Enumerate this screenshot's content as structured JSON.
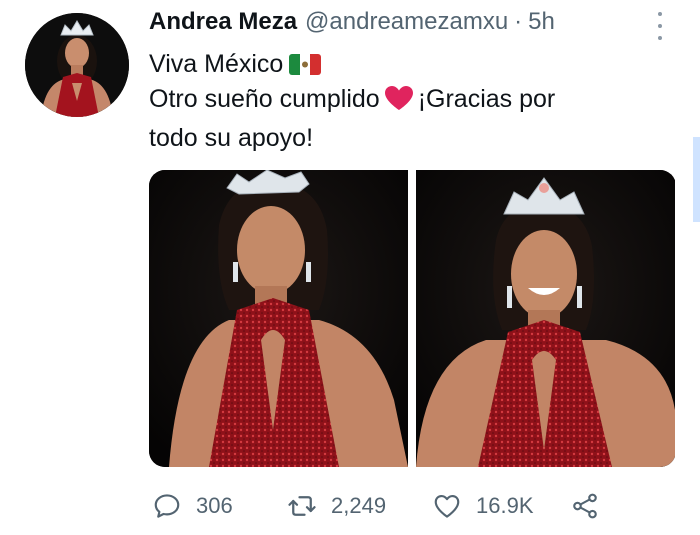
{
  "tweet": {
    "author_name": "Andrea Meza",
    "handle": "@andreamezamxu",
    "separator": "·",
    "time": "5h",
    "lines": [
      "Viva México",
      "Otro sueño cumplido",
      "¡Gracias por",
      "todo su apoyo!"
    ],
    "emoji": {
      "flag": "mexico-flag-icon",
      "heart": "red-heart-icon"
    }
  },
  "actions": {
    "reply_count": "306",
    "retweet_count": "2,249",
    "like_count": "16.9K"
  },
  "colors": {
    "text": "#0f1419",
    "secondary": "#536471",
    "heart": "#e0245e",
    "dress": "#a3131e"
  }
}
